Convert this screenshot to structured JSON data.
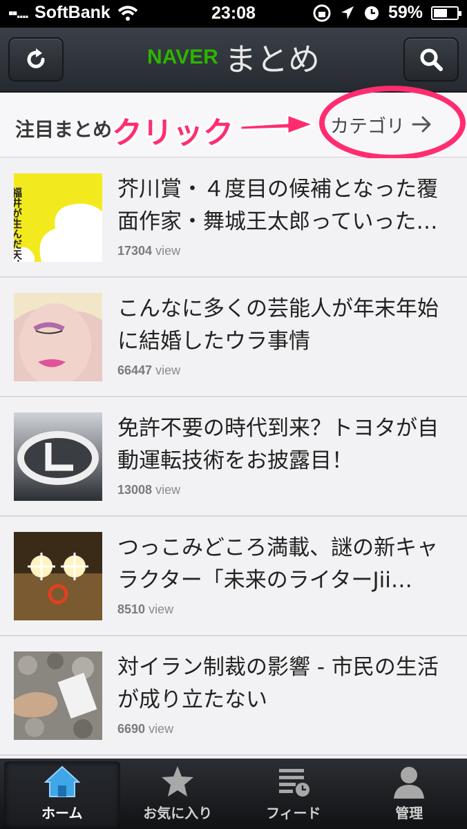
{
  "status_bar": {
    "carrier": "SoftBank",
    "time": "23:08",
    "battery": "59%",
    "battery_level": 0.59
  },
  "nav": {
    "logo_naver": "NAVER",
    "logo_matome": "まとめ",
    "refresh_icon": "refresh-icon",
    "search_icon": "search-icon"
  },
  "section": {
    "title": "注目まとめ",
    "annotation": "クリック",
    "category_link": "カテゴリ"
  },
  "items": [
    {
      "title": "芥川賞・４度目の候補となった覆面作家・舞城王太郎っていった…",
      "views": "17304",
      "views_unit": "view",
      "thumb_text": "福井が生んだ天才。"
    },
    {
      "title": "こんなに多くの芸能人が年末年始に結婚したウラ事情",
      "views": "66447",
      "views_unit": "view"
    },
    {
      "title": "免許不要の時代到来？トヨタが自動運転技術をお披露目！",
      "views": "13008",
      "views_unit": "view"
    },
    {
      "title": "つっこみどころ満載、謎の新キャラクター「未来のライターJii…",
      "views": "8510",
      "views_unit": "view"
    },
    {
      "title": "対イラン制裁の影響 - 市民の生活が成り立たない",
      "views": "6690",
      "views_unit": "view"
    }
  ],
  "tabs": [
    {
      "label": "ホーム",
      "icon": "home-icon",
      "active": true
    },
    {
      "label": "お気に入り",
      "icon": "star-icon",
      "active": false
    },
    {
      "label": "フィード",
      "icon": "feed-icon",
      "active": false
    },
    {
      "label": "管理",
      "icon": "user-icon",
      "active": false
    }
  ],
  "colors": {
    "accent_pink": "#ff2d6f",
    "naver_green": "#2db400",
    "home_blue": "#3fa6e8"
  }
}
